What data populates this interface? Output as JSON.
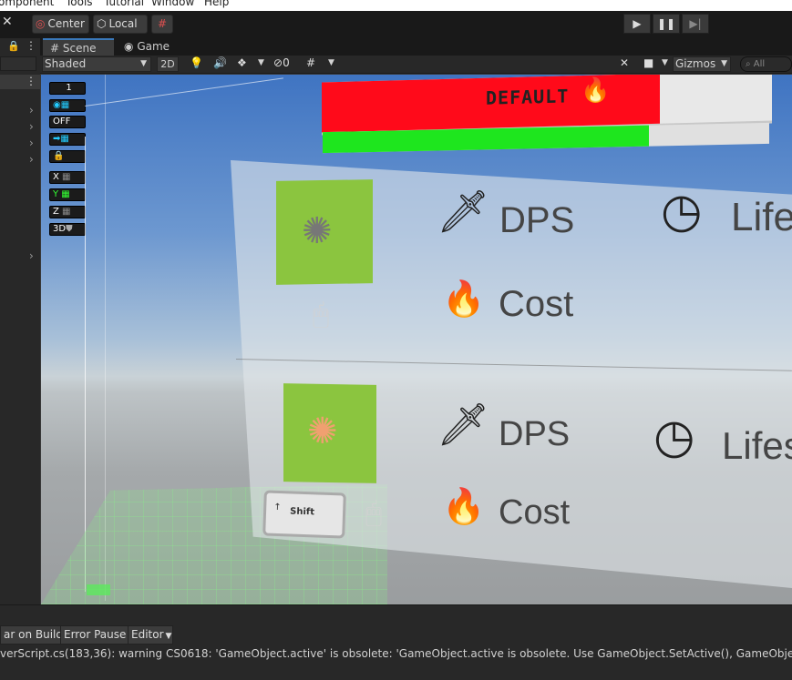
{
  "menu": [
    "omponent",
    "Tools",
    "Tutorial",
    "Window",
    "Help"
  ],
  "toolbar": {
    "pivot": "Center",
    "space": "Local"
  },
  "tabs": {
    "scene": "Scene",
    "game": "Game"
  },
  "scene_toolbar": {
    "draw_mode": "Shaded",
    "mode_2d": "2D",
    "hidden_count": "0",
    "gizmos": "Gizmos",
    "search_placeholder": "All"
  },
  "overlay": {
    "layer": "1",
    "off": "OFF",
    "x": "X",
    "y": "Y",
    "z": "Z",
    "d3": "3D"
  },
  "hud": {
    "mode_label": "DEFAULT",
    "health_fill": 0.75,
    "energy_fill": 0.73
  },
  "cards": [
    {
      "dps_label": "DPS",
      "cost_label": "Cost",
      "life_label": "Life"
    },
    {
      "dps_label": "DPS",
      "cost_label": "Cost",
      "life_label": "Lifes",
      "key_hint": "Shift"
    }
  ],
  "console": {
    "clear_on_build": "ar on Build",
    "error_pause": "Error Pause",
    "editor": "Editor",
    "message": "verScript.cs(183,36): warning CS0618: 'GameObject.active' is obsolete: 'GameObject.active is obsolete. Use GameObject.SetActive(), GameObject.activeSe"
  },
  "colors": {
    "health": "#ff0a1a",
    "energy": "#1ee61e",
    "tile": "#8bc53f",
    "accent": "#22ccff"
  }
}
